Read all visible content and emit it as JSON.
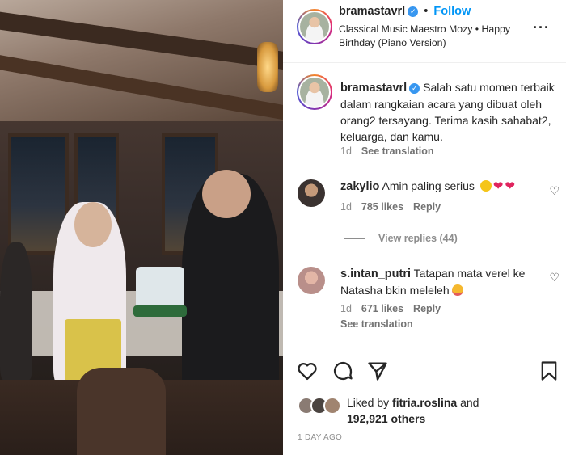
{
  "header": {
    "username": "bramastavrl",
    "follow_label": "Follow",
    "separator": "•",
    "subtitle": "Classical Music Maestro Mozy • Happy Birthday (Piano Version)",
    "more_icon": "more-horizontal-icon"
  },
  "caption": {
    "username": "bramastavrl",
    "text": "Salah satu momen terbaik dalam rangkaian acara yang dibuat oleh orang2 tersayang. Terima kasih sahabat2, keluarga, dan kamu.",
    "age": "1d",
    "see_translation": "See translation"
  },
  "comments": [
    {
      "username": "zakylio",
      "text": "Amin paling serius",
      "age": "1d",
      "likes": "785 likes",
      "reply": "Reply",
      "view_replies": "View replies (44)"
    },
    {
      "username": "s.intan_putri",
      "text": "Tatapan mata verel ke Natasha bkin meleleh",
      "age": "1d",
      "likes": "671 likes",
      "reply": "Reply",
      "see_translation": "See translation"
    }
  ],
  "likes": {
    "prefix": "Liked by",
    "user": "fitria.roslina",
    "and": "and",
    "others": "192,921 others"
  },
  "timestamp": "1 DAY AGO",
  "icons": {
    "like": "heart-icon",
    "comment": "comment-icon",
    "share": "share-icon",
    "save": "bookmark-icon"
  },
  "colors": {
    "follow": "#0095f6",
    "verified": "#3897f0",
    "muted": "#8e8e8e"
  }
}
